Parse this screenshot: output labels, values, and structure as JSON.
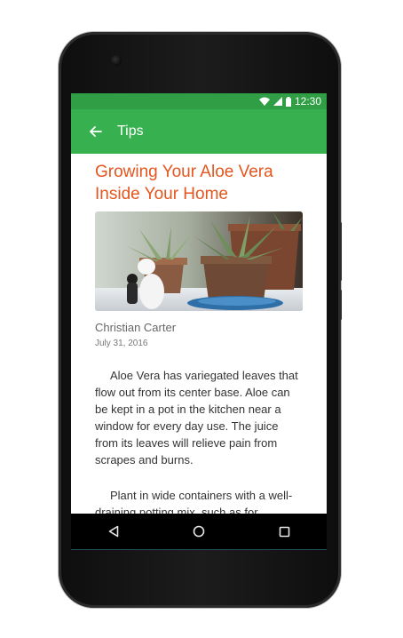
{
  "status_bar": {
    "time": "12:30",
    "icons": [
      "wifi-icon",
      "cell-signal-icon",
      "battery-icon"
    ]
  },
  "app_bar": {
    "back_icon": "back-arrow-icon",
    "title": "Tips"
  },
  "article": {
    "title": "Growing Your Aloe Vera Inside Your Home",
    "image": "aloe-vera-plant-photo",
    "author": "Christian Carter",
    "date": "July 31, 2016",
    "paragraphs": [
      "Aloe Vera has variegated leaves that flow out from its center base. Aloe can be kept in a pot in the kitchen near a window for every day use. The juice from its leaves will relieve pain from scrapes and burns.",
      "Plant in wide containers with a well-draining potting mix, such as for cacti/succulents. Place in indirect sunlight or artificial light."
    ]
  },
  "nav_bar": {
    "icons": [
      "back-triangle-icon",
      "home-circle-icon",
      "recents-square-icon"
    ]
  },
  "colors": {
    "status_bar": "#2f9e45",
    "app_bar": "#37b04f",
    "title_accent": "#e4561f"
  }
}
